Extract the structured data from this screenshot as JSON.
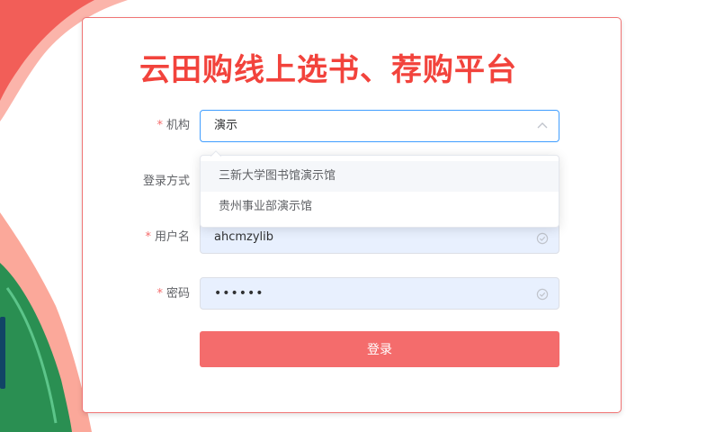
{
  "title": "云田购线上选书、荐购平台",
  "form": {
    "org": {
      "label": "机构",
      "required_mark": "*",
      "value": "演示",
      "options": [
        "三新大学图书馆演示馆",
        "贵州事业部演示馆"
      ]
    },
    "login_mode": {
      "label": "登录方式"
    },
    "username": {
      "label": "用户名",
      "required_mark": "*",
      "value": "ahcmzylib"
    },
    "password": {
      "label": "密码",
      "required_mark": "*",
      "value": "••••••"
    },
    "submit_label": "登录"
  },
  "colors": {
    "title": "#f2433c",
    "button": "#f46c6c",
    "card_border": "#f07474",
    "autofill": "#e8f0fe",
    "focus_border": "#409eff"
  },
  "icons": {
    "org_select": "chevron-up-icon",
    "username_status": "check-circle-icon",
    "password_status": "check-circle-icon"
  }
}
